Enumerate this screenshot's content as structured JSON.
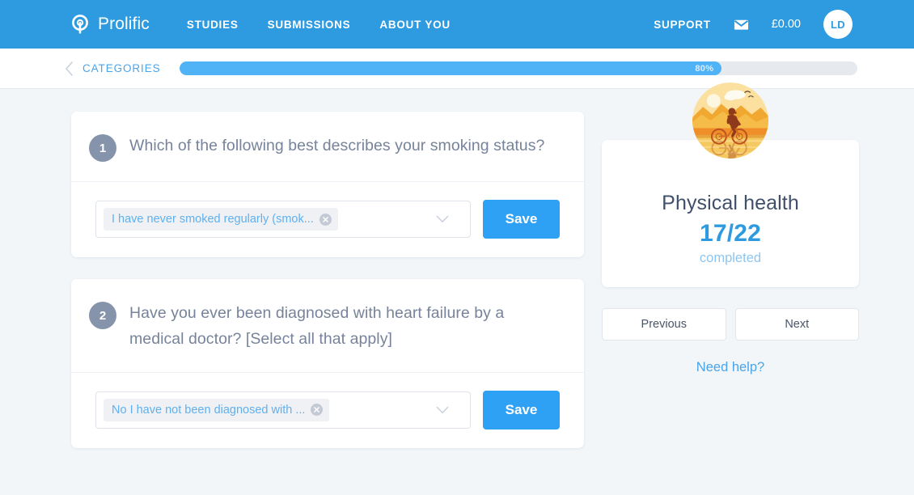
{
  "navbar": {
    "brand": "Prolific",
    "brand_icon": "prolific-logo-icon",
    "links": [
      {
        "label": "STUDIES"
      },
      {
        "label": "SUBMISSIONS"
      },
      {
        "label": "ABOUT YOU"
      }
    ],
    "support_label": "SUPPORT",
    "mail_icon": "envelope-icon",
    "balance": "£0.00",
    "avatar_initials": "LD",
    "background_color": "#2e9be0"
  },
  "subbar": {
    "back_icon": "chevron-left-icon",
    "back_label": "CATEGORIES",
    "progress_percent": 80,
    "progress_label": "80%",
    "fill_color": "#4fb3f6",
    "track_color": "#e6eaee"
  },
  "questions": [
    {
      "number": "1",
      "text": "Which of the following best describes your smoking status?",
      "answer_chip": "I have never smoked regularly (smok...",
      "remove_icon": "close-circle-icon",
      "caret_icon": "chevron-down-icon",
      "save_label": "Save"
    },
    {
      "number": "2",
      "text": "Have you ever been diagnosed with heart failure by a medical doctor? [Select all that apply]",
      "answer_chip": "No I have not been diagnosed with ...",
      "remove_icon": "close-circle-icon",
      "caret_icon": "chevron-down-icon",
      "save_label": "Save"
    }
  ],
  "sidebar": {
    "category_icon": "cyclist-sunset-icon",
    "title": "Physical health",
    "count": "17/22",
    "completed_label": "completed",
    "previous_label": "Previous",
    "next_label": "Next",
    "help_label": "Need help?",
    "accent_color": "#2e9be0"
  }
}
